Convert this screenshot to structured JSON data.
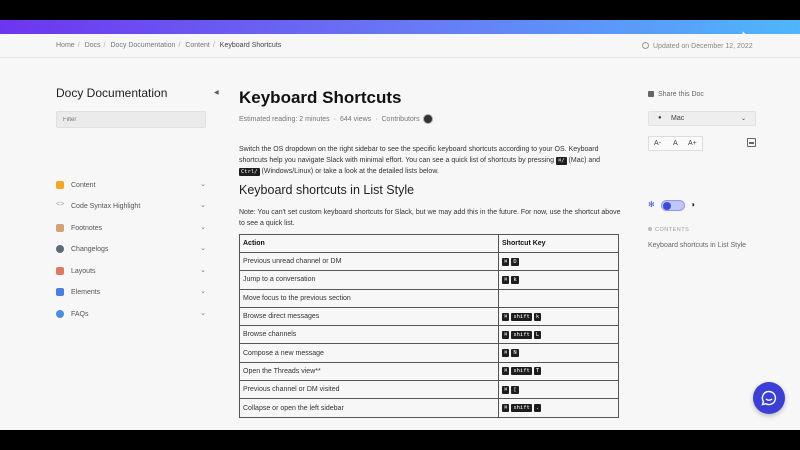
{
  "breadcrumb": [
    "Home",
    "Docs",
    "Docy Documentation",
    "Content",
    "Keyboard Shortcuts"
  ],
  "updated": "Updated on December 12, 2022",
  "sidebar": {
    "title": "Docy Documentation",
    "filter_placeholder": "Filter",
    "items": [
      {
        "label": "Content",
        "icon": "content-icon",
        "color": "#f5a623"
      },
      {
        "label": "Code Syntax Highlight",
        "icon": "code-icon",
        "color": "#9aa0a6"
      },
      {
        "label": "Footnotes",
        "icon": "footnotes-icon",
        "color": "#d4a373"
      },
      {
        "label": "Changelogs",
        "icon": "changelogs-icon",
        "color": "#5b6b7a"
      },
      {
        "label": "Layouts",
        "icon": "layouts-icon",
        "color": "#e07a5f"
      },
      {
        "label": "Elements",
        "icon": "elements-icon",
        "color": "#4a7de8"
      },
      {
        "label": "FAQs",
        "icon": "faqs-icon",
        "color": "#4a90e2"
      }
    ]
  },
  "main": {
    "title": "Keyboard Shortcuts",
    "meta": {
      "reading": "Estimated reading: 2 minutes",
      "views": "644 views",
      "contributors": "Contributors"
    },
    "intro": {
      "part1": "Switch the OS dropdown on the right sidebar to see the specific keyboard shortcuts according to your OS. Keyboard shortcuts help you navigate Slack with minimal effort. You can see a quick list of shortcuts by pressing ",
      "mac_key": "⌘/",
      "part2": " (Mac) and ",
      "win_key": "Ctrl/",
      "part3": " (Windows/Linux) or take a look at the detailed lists below."
    },
    "heading": "Keyboard shortcuts in List Style",
    "note": "Note: You can't set custom keyboard shortcuts for Slack, but we may add this in the future. For now, use the shortcut above to see a quick list.",
    "table": {
      "headers": [
        "Action",
        "Shortcut Key"
      ],
      "rows": [
        {
          "action": "Previous unread channel or DM",
          "keys": [
            "⌘",
            "D"
          ]
        },
        {
          "action": "Jump to a conversation",
          "keys": [
            "⌘",
            "k"
          ]
        },
        {
          "action": "Move focus to the previous section",
          "keys": []
        },
        {
          "action": "Browse direct messages",
          "keys": [
            "⌘",
            "shift",
            "k"
          ]
        },
        {
          "action": "Browse channels",
          "keys": [
            "⌘",
            "shift",
            "L"
          ]
        },
        {
          "action": "Compose a new message",
          "keys": [
            "⌘",
            "N"
          ]
        },
        {
          "action": "Open the Threads view**",
          "keys": [
            "⌘",
            "shift",
            "T"
          ]
        },
        {
          "action": "Previous channel or DM visited",
          "keys": [
            "⌘",
            "["
          ]
        },
        {
          "action": "Collapse or open the left sidebar",
          "keys": [
            "⌘",
            "shift",
            "."
          ]
        }
      ]
    }
  },
  "right": {
    "share": "Share this Doc",
    "os_value": "Mac",
    "font_buttons": [
      "A-",
      "A",
      "A+"
    ],
    "contents_heading": "CONTENTS",
    "contents_items": [
      "Keyboard shortcuts in List Style"
    ]
  },
  "colors": {
    "gradient_start": "#6d35ef",
    "gradient_end": "#4fb6fb",
    "accent": "#3b3fd8"
  }
}
